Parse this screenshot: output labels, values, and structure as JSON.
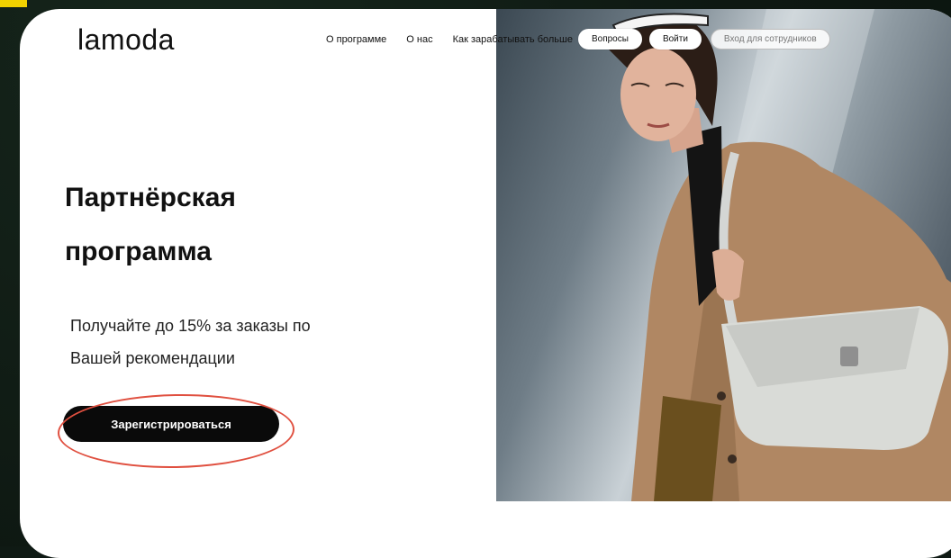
{
  "brand": {
    "logo": "lamoda"
  },
  "nav": {
    "links": [
      "О программе",
      "О нас",
      "Как зарабатывать больше"
    ],
    "questions_label": "Вопросы",
    "login_label": "Войти",
    "staff_label": "Вход для сотрудников"
  },
  "hero": {
    "title_line1": "Партнёрская",
    "title_line2": "программа",
    "subtitle_line1": "Получайте до 15% за заказы по",
    "subtitle_line2": "Вашей рекомендации",
    "cta_label": "Зарегистрироваться"
  },
  "colors": {
    "background": "#0f1a14",
    "accent_marker": "#f2d200",
    "highlight_circle": "#e05040",
    "button": "#0a0a0a"
  }
}
